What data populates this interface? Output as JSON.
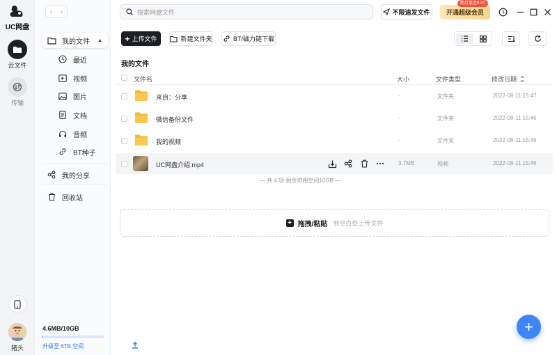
{
  "app": {
    "name": "UC网盘"
  },
  "rail": {
    "items": [
      {
        "label": "云文件",
        "icon": "folder-icon",
        "active": true
      },
      {
        "label": "传输",
        "icon": "transfer-icon",
        "active": false
      }
    ],
    "user_name": "猪头"
  },
  "sidebar": {
    "my_files": "我的文件",
    "sub_items": [
      "最近",
      "视频",
      "图片",
      "文档",
      "音频",
      "BT种子"
    ],
    "my_share": "我的分享",
    "recycle": "回收站",
    "storage_used": "4.6MB/10GB",
    "storage_fraction": 0.0005,
    "upgrade_text": "升级至 6TB 空间"
  },
  "topbar": {
    "search_placeholder": "搜索网盘文件",
    "speed_label": "不限速发文件",
    "vip_label": "开通超级会员",
    "vip_tag": "购月低至8.80"
  },
  "toolbar": {
    "upload": "上传文件",
    "new_folder": "新建文件夹",
    "bt_download": "BT/磁力链下载"
  },
  "page_title": "我的文件",
  "table": {
    "headers": {
      "name": "文件名",
      "size": "大小",
      "type": "文件类型",
      "date": "修改日期"
    },
    "rows": [
      {
        "name": "来自：分享",
        "size": "-",
        "type": "文件夹",
        "date": "2022-08-11 15:47",
        "kind": "folder"
      },
      {
        "name": "微信备份文件",
        "size": "-",
        "type": "文件夹",
        "date": "2022-08-11 15:46",
        "kind": "folder"
      },
      {
        "name": "我的视频",
        "size": "-",
        "type": "文件夹",
        "date": "2022-08-11 15:46",
        "kind": "folder"
      },
      {
        "name": "UC网盘介绍.mp4",
        "size": "3.7MB",
        "type": "视频",
        "date": "2022-08-11 15:46",
        "kind": "video"
      }
    ],
    "summary": "— 共 4 项 剩余可用空间10GB —"
  },
  "dropzone": {
    "action": "拖拽/粘贴",
    "hint": "到空白处上传文件"
  },
  "colors": {
    "accent": "#3e86f6",
    "dark": "#1e1f24",
    "folder": "#f6b93b"
  }
}
